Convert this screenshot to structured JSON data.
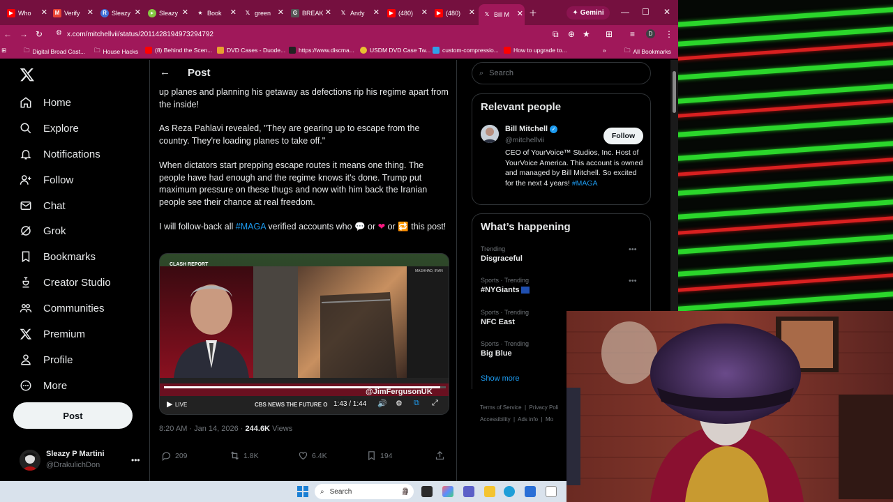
{
  "browser": {
    "tabs": [
      {
        "label": "Who",
        "icon": "youtube-icon",
        "color": "#ff0000"
      },
      {
        "label": "Verify",
        "icon": "gmail-icon",
        "color": "#ea4335"
      },
      {
        "label": "Sleazy",
        "icon": "r-icon",
        "color": "#3f6fd8"
      },
      {
        "label": "Sleazy",
        "icon": "rumble-icon",
        "color": "#85c742"
      },
      {
        "label": "Book",
        "icon": "star-icon",
        "color": "#ffffff"
      },
      {
        "label": "green",
        "icon": "x-icon",
        "color": "#000000"
      },
      {
        "label": "BREAK",
        "icon": "gp-icon",
        "color": "#555555"
      },
      {
        "label": "Andy",
        "icon": "x-icon",
        "color": "#000000"
      },
      {
        "label": "(480)",
        "icon": "youtube-icon",
        "color": "#ff0000"
      },
      {
        "label": "(480)",
        "icon": "youtube-icon",
        "color": "#ff0000"
      },
      {
        "label": "Bill M",
        "icon": "x-icon",
        "color": "#000000"
      }
    ],
    "gemini_label": "Gemini",
    "url": "x.com/mitchellvii/status/2011428194973294792",
    "bookmarks": [
      "Digital Broad Cast...",
      "House Hacks",
      "(8) Behind the Scen...",
      "DVD Cases - Duode...",
      "https://www.discma...",
      "USDM DVD Case Tw...",
      "custom-compressio...",
      "How to upgrade to..."
    ],
    "all_bookmarks": "All Bookmarks"
  },
  "nav": {
    "items": [
      "Home",
      "Explore",
      "Notifications",
      "Follow",
      "Chat",
      "Grok",
      "Bookmarks",
      "Creator Studio",
      "Communities",
      "Premium",
      "Profile",
      "More"
    ],
    "post_button": "Post",
    "account_name": "Sleazy P Martini",
    "account_handle": "@DrakulichDon"
  },
  "post": {
    "header_title": "Post",
    "para1": "up planes and planning his getaway as defections rip his regime apart from the inside!",
    "para2": "As Reza Pahlavi revealed, \"They are gearing up to escape from the country. They're loading planes to take off.\"",
    "para3": "When dictators start prepping escape routes it means one thing. The people have had enough and the regime knows it's done. Trump put maximum pressure on these thugs and now with him back the Iranian people see their chance at real freedom.",
    "para4_a": "I will follow-back all ",
    "para4_tag": "#MAGA",
    "para4_b": " verified accounts who ",
    "para4_or1": " or ",
    "para4_or2": " or ",
    "para4_c": " this post!",
    "video": {
      "brand": "CLASH REPORT",
      "location": "MASHHAD, IRAN",
      "watermark": "@JimFergusonUK",
      "lower_third": "CBS NEWS  THE FUTURE O",
      "live": "LIVE",
      "time": "1:43 / 1:44",
      "progress": 0.98
    },
    "time": "8:20 AM · Jan 14, 2026 · ",
    "views": "244.6K",
    "views_label": " Views",
    "replies": "209",
    "reposts": "1.8K",
    "likes": "6.4K",
    "bookmarks": "194"
  },
  "right": {
    "search_placeholder": "Search",
    "relevant_title": "Relevant people",
    "person_name": "Bill Mitchell",
    "person_handle": "@mitchellvii",
    "person_bio": "CEO of YourVoice™ Studios, Inc. Host of YourVoice America. This account is owned and managed by Bill Mitchell. So excited for the next 4 years!",
    "person_tag": "#MAGA",
    "follow": "Follow",
    "happening_title": "What’s happening",
    "trends": [
      {
        "category": "Trending",
        "name": "Disgraceful"
      },
      {
        "category": "Sports · Trending",
        "name": "#NYGiants"
      },
      {
        "category": "Sports · Trending",
        "name": "NFC East"
      },
      {
        "category": "Sports · Trending",
        "name": "Big Blue"
      }
    ],
    "show_more": "Show more",
    "footer_links": [
      "Terms of Service",
      "Privacy Poli",
      "Accessibility",
      "Ads info",
      "Mo"
    ]
  },
  "taskbar": {
    "search": "Search"
  },
  "colors": {
    "accent": "#1d9bf0",
    "tabbar": "#75103f",
    "toolbar": "#a0185a"
  }
}
